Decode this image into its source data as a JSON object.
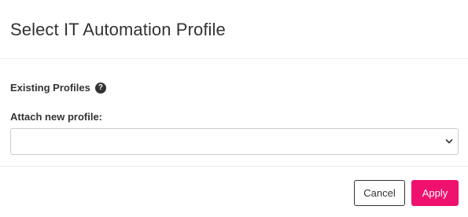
{
  "dialog": {
    "title": "Select IT Automation Profile"
  },
  "existing_profiles": {
    "label": "Existing Profiles",
    "help_icon": "question-circle-icon",
    "help_glyph": "?"
  },
  "attach": {
    "label": "Attach new profile:",
    "selected_value": "",
    "chevron_icon": "chevron-down-icon"
  },
  "footer": {
    "cancel_label": "Cancel",
    "apply_label": "Apply"
  },
  "colors": {
    "primary": "#f0106e",
    "text": "#333333",
    "border": "#cccccc"
  }
}
